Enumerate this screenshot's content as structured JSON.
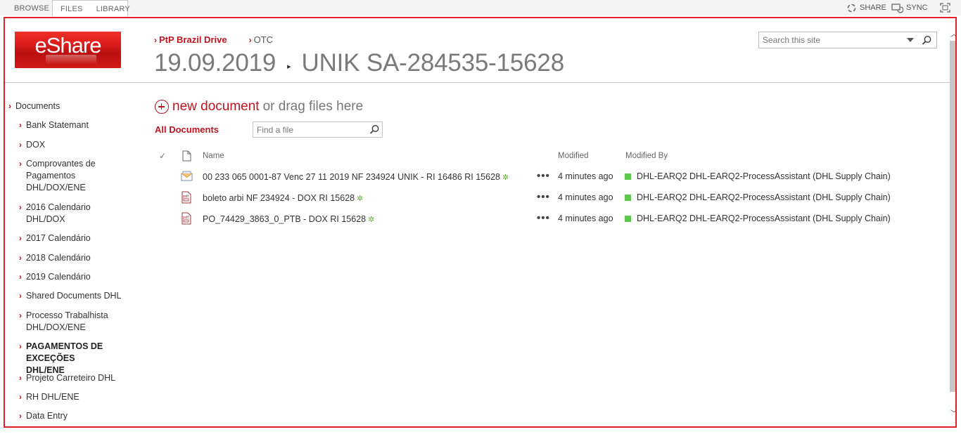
{
  "ribbon": {
    "tabs": [
      "BROWSE",
      "FILES",
      "LIBRARY"
    ],
    "share_label": "SHARE",
    "sync_label": "SYNC"
  },
  "logo_text": "eShare",
  "breadcrumb": [
    "PtP Brazil Drive",
    "OTC"
  ],
  "title": {
    "folder": "19.09.2019",
    "item": "UNIK SA-284535-15628"
  },
  "search_site": {
    "placeholder": "Search this site"
  },
  "nav": {
    "root": "Documents",
    "items": [
      "Bank Statemant",
      "DOX",
      "Comprovantes de Pagamentos DHL/DOX/ENE",
      "2016 Calendario DHL/DOX",
      "2017 Calendário",
      "2018 Calendário",
      "2019 Calendário",
      "Shared Documents DHL",
      "Processo Trabalhista DHL/DOX/ENE",
      "PAGAMENTOS DE EXCEÇÕES DHL/ENE",
      "Projeto Carreteiro DHL",
      "RH DHL/ENE",
      "Data Entry"
    ]
  },
  "main": {
    "new_document": "new document",
    "drag_text": "or drag files here",
    "view_label": "All Documents",
    "find_file_placeholder": "Find a file",
    "columns": {
      "name": "Name",
      "modified": "Modified",
      "modified_by": "Modified By"
    },
    "rows": [
      {
        "icon": "email-icon",
        "name": "00 233 065 0001-87 Venc 27 11 2019 NF 234924 UNIK - RI 16486 RI 15628",
        "modified": "4 minutes ago",
        "modified_by": "DHL-EARQ2 DHL-EARQ2-ProcessAssistant (DHL Supply Chain)"
      },
      {
        "icon": "pdf-icon",
        "name": "boleto arbi NF 234924 - DOX RI 15628",
        "modified": "4 minutes ago",
        "modified_by": "DHL-EARQ2 DHL-EARQ2-ProcessAssistant (DHL Supply Chain)"
      },
      {
        "icon": "pdf-icon",
        "name": "PO_74429_3863_0_PTB - DOX RI 15628",
        "modified": "4 minutes ago",
        "modified_by": "DHL-EARQ2 DHL-EARQ2-ProcessAssistant (DHL Supply Chain)"
      }
    ],
    "new_badge": "✲",
    "ellipsis": "•••"
  },
  "colors": {
    "accent": "#c1131e",
    "frame": "#e31e24",
    "presence": "#5dc94a"
  }
}
